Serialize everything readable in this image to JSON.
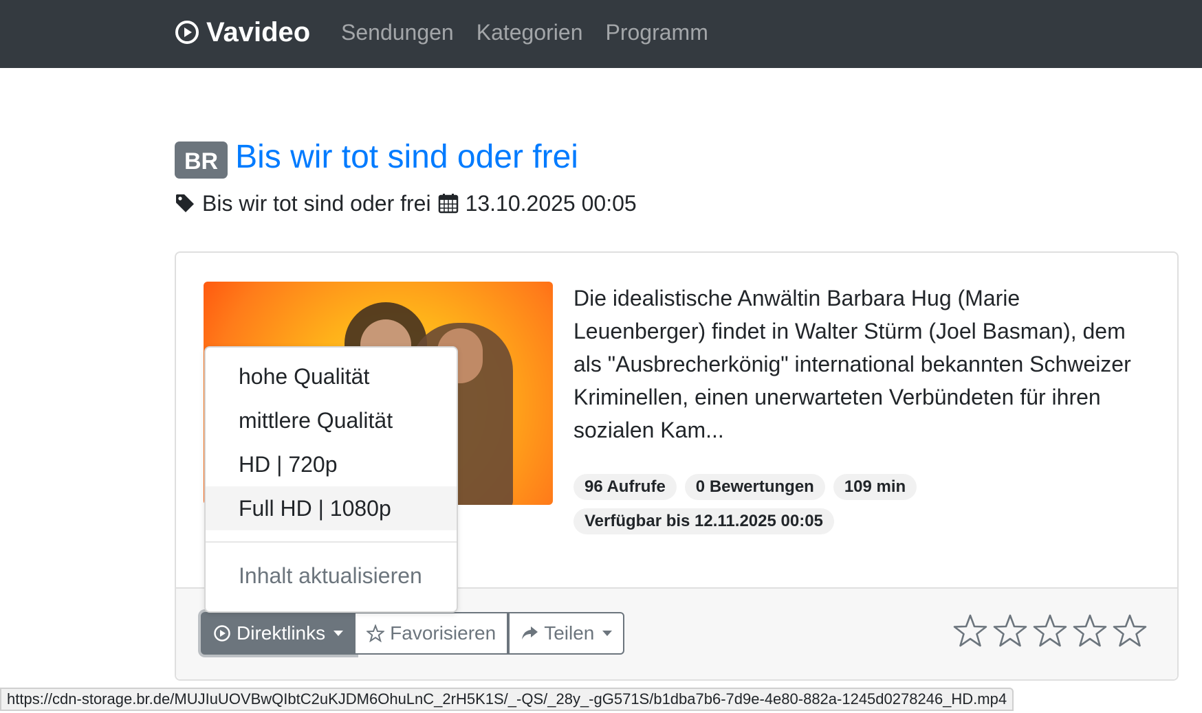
{
  "navbar": {
    "brand": "Vavideo",
    "links": [
      "Sendungen",
      "Kategorien",
      "Programm"
    ]
  },
  "show": {
    "station": "BR",
    "title": "Bis wir tot sind oder frei",
    "tag": "Bis wir tot sind oder frei",
    "date": "13.10.2025 00:05",
    "description": "Die idealistische Anwältin Barbara Hug (Marie Leuenberger) findet in Walter Stürm (Joel Basman), dem als \"Ausbrecherkönig\" international bekannten Schweizer Kriminellen, einen unerwarteten Verbündeten für ihren sozialen Kam...",
    "badges": {
      "views": "96 Aufrufe",
      "ratings": "0 Bewertungen",
      "duration": "109 min",
      "available": "Verfügbar bis 12.11.2025 00:05"
    }
  },
  "actions": {
    "direktlinks": "Direktlinks",
    "favorite": "Favorisieren",
    "share": "Teilen",
    "rating_stars": 0,
    "rating_max": 5
  },
  "dropdown": {
    "items": [
      "hohe Qualität",
      "mittlere Qualität",
      "HD | 720p",
      "Full HD | 1080p"
    ],
    "highlighted": "Full HD | 1080p",
    "refresh": "Inhalt aktualisieren"
  },
  "status_url": "https://cdn-storage.br.de/MUJIuUOVBwQIbtC2uKJDM6OhuLnC_2rH5K1S/_-QS/_28y_-gG571S/b1dba7b6-7d9e-4e80-882a-1245d0278246_HD.mp4",
  "colors": {
    "navbar": "#343a40",
    "link": "#007bff",
    "secondary": "#6c757d"
  }
}
